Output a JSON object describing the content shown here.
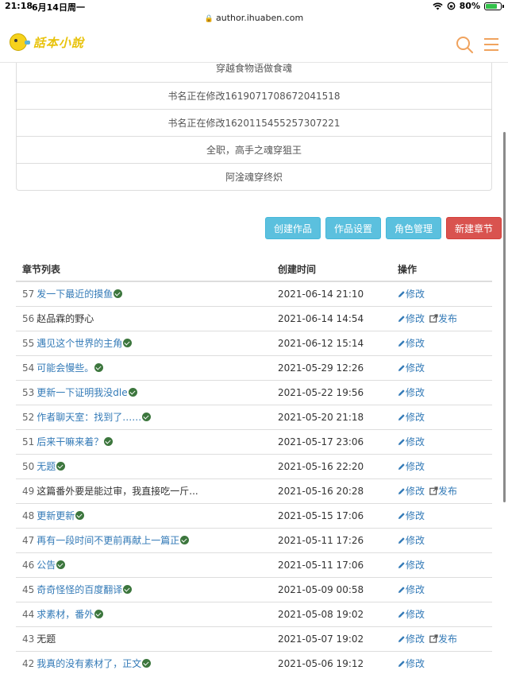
{
  "status": {
    "time": "21:18",
    "date": "6月14日周一",
    "battery": "80%",
    "battery_level": 0.8
  },
  "browser": {
    "url": "author.ihuaben.com"
  },
  "header": {
    "logo_text": "話本小說"
  },
  "works": [
    "穿越食物语做食魂",
    "书名正在修改1619071708672041518",
    "书名正在修改1620115455257307221",
    "全职，高手之魂穿狙王",
    "阿淦魂穿终炽"
  ],
  "buttons": {
    "create_work": "创建作品",
    "work_settings": "作品设置",
    "role_manage": "角色管理",
    "new_chapter": "新建章节"
  },
  "colors": {
    "info": "#5bc0de",
    "danger": "#d9534f",
    "link": "#337ab7",
    "success": "#3c763d"
  },
  "table": {
    "headers": {
      "title": "章节列表",
      "time": "创建时间",
      "action": "操作"
    },
    "edit_label": "修改",
    "publish_label": "发布",
    "rows": [
      {
        "num": "57",
        "title": "发一下最近的摸鱼",
        "published": true,
        "time": "2021-06-14 21:10"
      },
      {
        "num": "56",
        "title": "赵品霖的野心",
        "published": false,
        "time": "2021-06-14 14:54"
      },
      {
        "num": "55",
        "title": "遇见这个世界的主角",
        "published": true,
        "time": "2021-06-12 15:14"
      },
      {
        "num": "54",
        "title": "可能会慢些。",
        "published": true,
        "time": "2021-05-29 12:26"
      },
      {
        "num": "53",
        "title": "更新一下证明我没dle",
        "published": true,
        "time": "2021-05-22 19:56"
      },
      {
        "num": "52",
        "title": "作者聊天室：找到了……",
        "published": true,
        "time": "2021-05-20 21:18"
      },
      {
        "num": "51",
        "title": "后来干嘛来着？",
        "published": true,
        "time": "2021-05-17 23:06"
      },
      {
        "num": "50",
        "title": "无题",
        "published": true,
        "time": "2021-05-16 22:20"
      },
      {
        "num": "49",
        "title": "这篇番外要是能过审，我直接吃一斤...",
        "published": false,
        "time": "2021-05-16 20:28"
      },
      {
        "num": "48",
        "title": "更新更新",
        "published": true,
        "time": "2021-05-15 17:06"
      },
      {
        "num": "47",
        "title": "再有一段时间不更前再献上一篇正",
        "published": true,
        "time": "2021-05-11 17:26"
      },
      {
        "num": "46",
        "title": "公告",
        "published": true,
        "time": "2021-05-11 17:06"
      },
      {
        "num": "45",
        "title": "奇奇怪怪的百度翻译",
        "published": true,
        "time": "2021-05-09 00:58"
      },
      {
        "num": "44",
        "title": "求素材，番外",
        "published": true,
        "time": "2021-05-08 19:02"
      },
      {
        "num": "43",
        "title": "无题",
        "published": false,
        "time": "2021-05-07 19:02"
      },
      {
        "num": "42",
        "title": "我真的没有素材了，正文",
        "published": true,
        "time": "2021-05-06 19:12"
      }
    ]
  }
}
